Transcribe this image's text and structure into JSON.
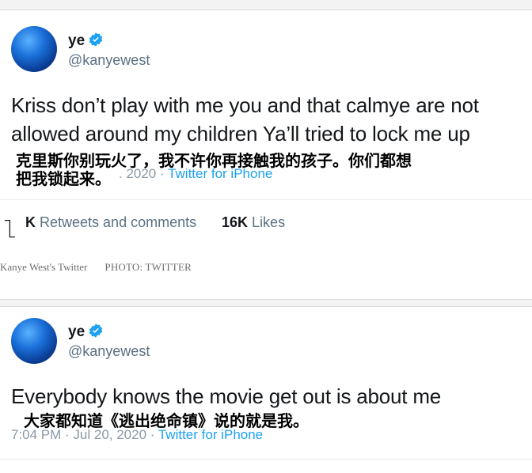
{
  "tweets": [
    {
      "display_name": "ye",
      "handle": "@kanyewest",
      "text_lines": [
        "Kriss don’t play with me  you and that calmye are not",
        "allowed around my children   Ya’ll tried to lock me up"
      ],
      "meta_time": "",
      "meta_sep": "·",
      "meta_partial": ". 2020 ·",
      "meta_source": "Twitter for iPhone",
      "caption_zh_lines": [
        "克里斯你别玩火了，我不许你再接触我的孩子。你们都想",
        "把我锁起来。"
      ],
      "stats": {
        "retweets_prefix": "K",
        "retweets_label": "Retweets and comments",
        "likes_count": "16K",
        "likes_label": "Likes"
      }
    },
    {
      "display_name": "ye",
      "handle": "@kanyewest",
      "text_lines": [
        "Everybody knows the movie get out is about me"
      ],
      "meta_time": "7:04 PM · Jul 20, 2020 ·",
      "meta_source": "Twitter for iPhone",
      "caption_zh_lines": [
        "大家都知道《逃出绝命镇》说的就是我。"
      ]
    }
  ],
  "credit": {
    "source": "Kanye West's Twitter",
    "photo": "PHOTO: TWITTER"
  },
  "colors": {
    "text": "#14171a",
    "secondary": "#5b7083",
    "link": "#1da1f2",
    "verified": "#1da1f2"
  },
  "icons": [
    "verified-badge-icon",
    "retweet-icon"
  ]
}
